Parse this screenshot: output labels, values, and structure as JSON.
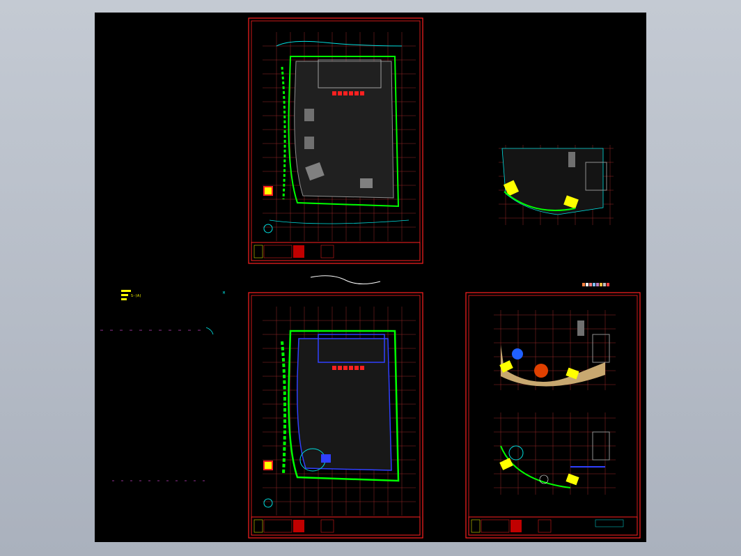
{
  "viewer": {
    "background_color": "#b8bec8",
    "canvas_color": "#000000"
  },
  "sheets": [
    {
      "id": "sheet-top-left",
      "type": "floor-plan",
      "title_block": "drawing-title-block"
    },
    {
      "id": "sheet-bottom-left",
      "type": "floor-plan",
      "title_block": "drawing-title-block"
    },
    {
      "id": "sheet-right",
      "type": "detail-plans",
      "title_block": "drawing-title-block"
    }
  ],
  "loose_annotations": {
    "label_a": "S-(A)",
    "marker": "M"
  },
  "colors": {
    "frame": "#ff2020",
    "grid": "#ff4040",
    "walls": "#808080",
    "landscape": "#00ff00",
    "cyan": "#00e0e0",
    "yellow": "#ffff00",
    "blue": "#3040ff",
    "tan": "#c8a870",
    "orange": "#e04000"
  }
}
